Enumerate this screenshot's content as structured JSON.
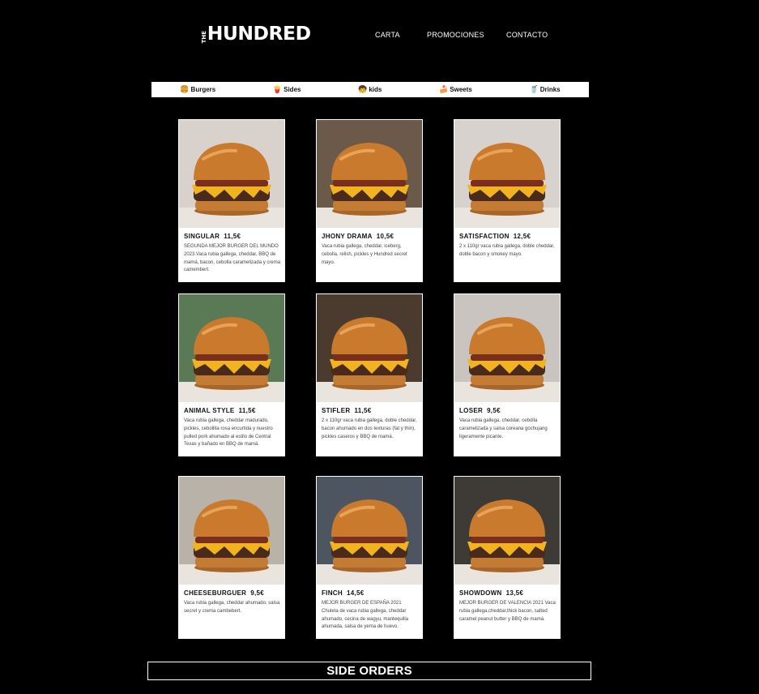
{
  "header": {
    "logo_small": "THE",
    "logo_text": "HUNDRED",
    "nav": [
      "CARTA",
      "PROMOCIONES",
      "CONTACTO"
    ]
  },
  "tabs": [
    {
      "icon": "burger-icon",
      "label": "Burgers",
      "glyph": "🍔"
    },
    {
      "icon": "fries-icon",
      "label": "Sides",
      "glyph": "🍟"
    },
    {
      "icon": "kids-icon",
      "label": "kids",
      "glyph": "🧒"
    },
    {
      "icon": "cake-icon",
      "label": "Sweets",
      "glyph": "🍰"
    },
    {
      "icon": "drink-icon",
      "label": "Drinks",
      "glyph": "🥤"
    }
  ],
  "products": [
    {
      "name": "SINGULAR",
      "price": "11,5€",
      "description": "SEGUNDA MEJOR BURGER DEL MUNDO 2023.Vaca rubia gallega, cheddar, BBQ de mamá, bacon, cebolla caramelizada y crema camembert."
    },
    {
      "name": "JHONY DRAMA",
      "price": "10,5€",
      "description": "Vaca rubia gallega, cheddar, iceberg, cebolla, relish, pickles y Hundred secret mayo."
    },
    {
      "name": "SATISFACTION",
      "price": "12,5€",
      "description": "2 x 110gr vaca rubia gallega, doble cheddar, doble bacon y smokey mayo."
    },
    {
      "name": "ANIMAL STYLE",
      "price": "11,5€",
      "description": "Vaca rubia gallega, cheddar madurado, pickles, cebollita rosa encurtida y nuestro pulled pork ahumado al estilo de Central Texas y bañado en BBQ de mamá."
    },
    {
      "name": "STIFLER",
      "price": "11,5€",
      "description": "2 x 110gr vaca rubia gallega, doble cheddar, bacon ahumado en dos texturas (fat y thin), pickles caseros y BBQ de mamá."
    },
    {
      "name": "LOSER",
      "price": "9,5€",
      "description": "Vaca rubia gallega, cheddar, cebolla caramelizada y salsa coreana gochujang ligeramente picante."
    },
    {
      "name": "CHEESEBURGUER",
      "price": "9,5€",
      "description": "Vaca rubia gallega, cheddar ahumado, salsa secret y crema cambebert."
    },
    {
      "name": "FINCH",
      "price": "14,5€",
      "description": "MEJOR BURGER DE ESPAÑA 2021 Chuleta de vaca rubia gallega, cheddar ahumado, cecina de wagyu, mantequilla ahumada, salsa de yema de huevo."
    },
    {
      "name": "SHOWDOWN",
      "price": "13,5€",
      "description": "MEJOR BURGER DE VALENCIA 2021 Vaca rubia gallega,cheddar,thick bacon, salted caramel peanut butter y BBQ de mamá."
    }
  ],
  "section": {
    "side_orders": "SIDE ORDERS"
  },
  "colors": {
    "background": "#000000",
    "card": "#ffffff",
    "bun": "#c97a2c",
    "cheese": "#f2b321"
  }
}
